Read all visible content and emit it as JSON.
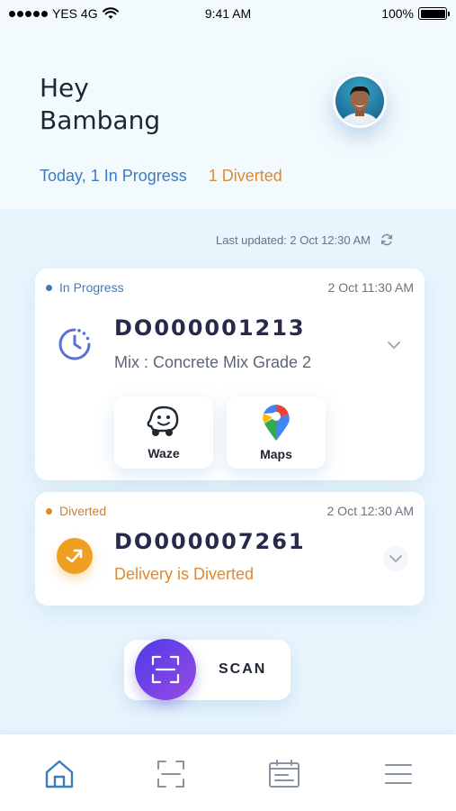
{
  "status_bar": {
    "carrier": "YES 4G",
    "time": "9:41 AM",
    "battery": "100%"
  },
  "header": {
    "greeting_line1": "Hey",
    "greeting_line2": "Bambang",
    "summary_in_progress": "Today, 1 In Progress",
    "summary_diverted": "1 Diverted"
  },
  "last_updated": "Last updated: 2 Oct 12:30 AM",
  "orders": [
    {
      "status": "In Progress",
      "time": "2 Oct 11:30 AM",
      "number": "DO000001213",
      "subtitle": "Mix : Concrete Mix Grade 2",
      "status_color": "#3b7bbf",
      "icon": "clock-icon",
      "nav_buttons": [
        {
          "label": "Waze",
          "icon": "waze-icon"
        },
        {
          "label": "Maps",
          "icon": "google-maps-icon"
        }
      ]
    },
    {
      "status": "Diverted",
      "time": "2 Oct 12:30 AM",
      "number": "DO000007261",
      "subtitle": "Delivery is Diverted",
      "status_color": "#e08a2a",
      "icon": "diverted-arrow-icon"
    }
  ],
  "scan": {
    "label": "SCAN",
    "icon": "scan-frame-icon"
  },
  "bottom_nav": [
    {
      "icon": "home-icon",
      "active": true
    },
    {
      "icon": "scan-icon",
      "active": false
    },
    {
      "icon": "calendar-icon",
      "active": false
    },
    {
      "icon": "menu-icon",
      "active": false
    }
  ],
  "colors": {
    "accent_blue": "#3b7bbf",
    "accent_orange": "#e08a2a",
    "scan_purple": "#6a40e6",
    "background": "#e8f5fd"
  }
}
